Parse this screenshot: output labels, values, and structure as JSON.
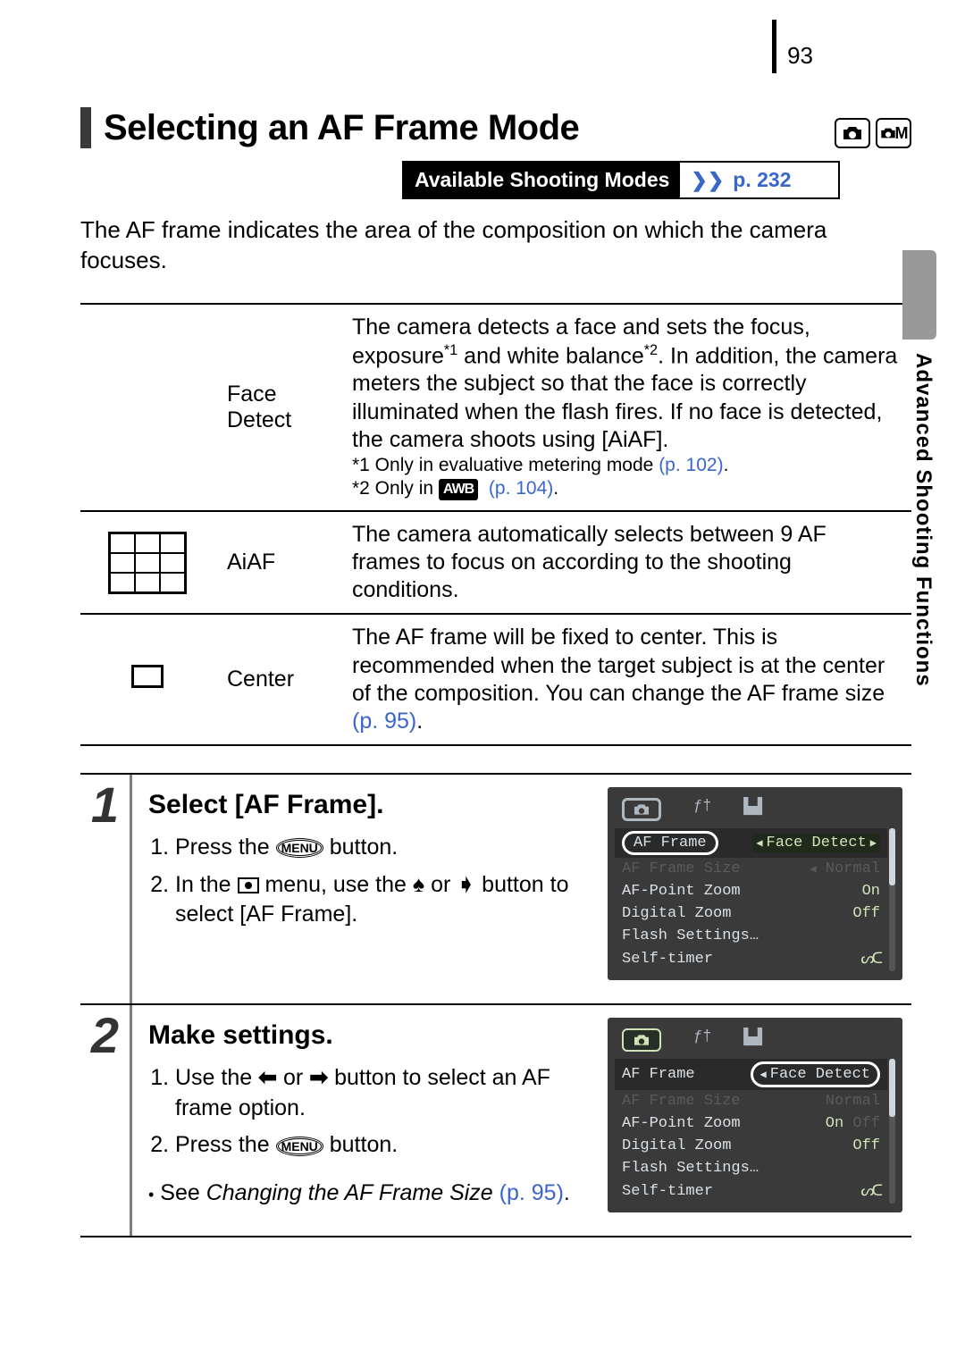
{
  "page_number": "93",
  "heading": "Selecting an AF Frame Mode",
  "available_modes_label": "Available Shooting Modes",
  "available_modes_ref": "p. 232",
  "intro": "The AF frame indicates the area of the composition on which the camera focuses.",
  "side_label": "Advanced Shooting Functions",
  "af_modes": {
    "face_detect": {
      "name": "Face Detect",
      "desc_a": "The camera detects a face and sets the focus, exposure",
      "desc_b": " and white balance",
      "desc_c": ". In addition, the camera meters the subject so that the face is correctly illuminated when the flash fires. If no face is detected, the camera shoots using [AiAF].",
      "fn1_prefix": "*1 Only in evaluative metering mode ",
      "fn1_ref": "(p. 102)",
      "fn2_prefix": "*2 Only in ",
      "fn2_badge": "AWB",
      "fn2_ref": "(p. 104)"
    },
    "aiaf": {
      "name": "AiAF",
      "desc": "The camera automatically selects between 9 AF frames to focus on according to the shooting conditions."
    },
    "center": {
      "name": "Center",
      "desc_a": "The AF frame will be fixed to center. This is recommended when the target subject is at the center of the composition. You can change the AF frame size ",
      "desc_ref": "(p. 95)",
      "desc_b": "."
    }
  },
  "steps": {
    "s1": {
      "num": "1",
      "title": "Select [AF Frame].",
      "li1_a": "Press the ",
      "li1_btn": "MENU",
      "li1_b": " button.",
      "li2_a": "In the ",
      "li2_b": " menu, use the ",
      "li2_c": " or ",
      "li2_d": " button to select [AF Frame]."
    },
    "s2": {
      "num": "2",
      "title": "Make settings.",
      "li1_a": "Use the ",
      "li1_b": " or ",
      "li1_c": " button to select an AF frame option.",
      "li2_a": "Press the ",
      "li2_btn": "MENU",
      "li2_b": " button.",
      "see_a": "See ",
      "see_i": "Changing the AF Frame Size",
      "see_ref": "(p. 95)",
      "see_b": "."
    }
  },
  "lcd": {
    "af_frame_label": "AF Frame",
    "face_detect": "Face Detect",
    "af_frame_size_label": "AF Frame Size",
    "af_frame_size_val": "Normal",
    "af_point_zoom_label": "AF-Point Zoom",
    "af_point_zoom_val": "On",
    "digital_zoom_label": "Digital Zoom",
    "digital_zoom_val": "Off",
    "flash_settings_label": "Flash Settings…",
    "self_timer_label": "Self-timer",
    "on_dim": "Off"
  },
  "mode_icon_m": "M"
}
